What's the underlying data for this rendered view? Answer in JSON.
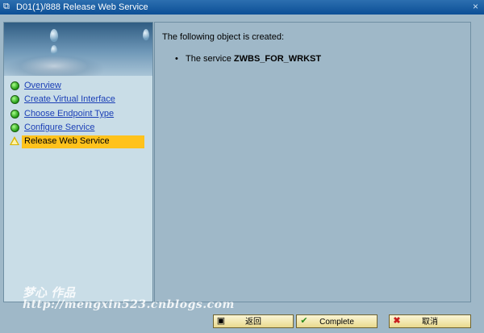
{
  "window": {
    "title": "D01(1)/888 Release Web Service",
    "close_label": "×"
  },
  "nav": {
    "items": [
      {
        "label": "Overview",
        "status": "green"
      },
      {
        "label": "Create Virtual Interface",
        "status": "green"
      },
      {
        "label": "Choose Endpoint Type",
        "status": "green"
      },
      {
        "label": "Configure Service",
        "status": "green"
      },
      {
        "label": "Release Web Service",
        "status": "warning",
        "active": true
      }
    ]
  },
  "content": {
    "heading": "The following object is created:",
    "bullet_symbol": "•",
    "bullet_prefix": "The service ",
    "bullet_value": "ZWBS_FOR_WRKST"
  },
  "watermark": {
    "logo_text": "梦心 作品",
    "url": "http://mengxin523.cnblogs.com"
  },
  "buttons": {
    "back_label": "返回",
    "complete_label": "Complete",
    "cancel_label": "取消"
  },
  "colors": {
    "titlebar": "#0c4f96",
    "active_step": "#ffc21c",
    "link": "#1b3fb6",
    "panel_bg": "#9fb8c8"
  }
}
